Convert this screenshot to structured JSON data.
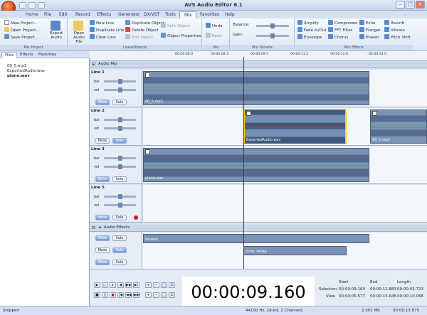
{
  "app": {
    "title": "AVS Audio Editor 6.1"
  },
  "menu": [
    "Home",
    "File",
    "Edit",
    "Record",
    "Effects",
    "Generator",
    "DX/VST",
    "Tools",
    "Mix",
    "Favorites",
    "Help"
  ],
  "active_menu": "Mix",
  "ribbon": {
    "mix_project": {
      "items": [
        "New Project...",
        "Open Project...",
        "Save Project..."
      ],
      "export": "Export Audio",
      "label": "Mix Project"
    },
    "lines_objects": {
      "open": "Open Audio File",
      "items": [
        "New Line",
        "Duplicate Line",
        "Clear Line",
        "Duplicate Object",
        "Delete Object",
        "Edit Object",
        "Split Object",
        "Object Properties"
      ],
      "label": "Lines/Objects"
    },
    "undo_redo": {
      "items": [
        "Undo",
        "Redo"
      ],
      "label": "Mix Undo/Redo"
    },
    "mix_volume": {
      "balance": "Balance:",
      "gain": "Gain:",
      "label": "Mix Volume"
    },
    "mix_effects": {
      "items": [
        "Amplify",
        "Compressor",
        "Echo",
        "Reverb",
        "Fade In/Out",
        "FFT Filter",
        "Flanger",
        "Vibrato",
        "Envelope",
        "Chorus",
        "Phaser",
        "Pitch Shift"
      ],
      "label": "Mix Effects"
    }
  },
  "left_panel": {
    "tabs": [
      "Files",
      "Effects",
      "Favorites"
    ],
    "files": [
      "00_5.mp3",
      "ExportedAudio.wav",
      "piano.wav"
    ]
  },
  "timeline": {
    "ticks": [
      "00:00:06.9",
      "00:00:08.3",
      "00:00:09.7",
      "00:00:11.2",
      "00:00:12.6",
      "00:00:14.0"
    ],
    "group": "Audio Mix"
  },
  "tracks": [
    {
      "name": "Line 1",
      "mute": "Mute",
      "solo": "Solo",
      "clips": [
        "00_5.mp3"
      ]
    },
    {
      "name": "Line 2",
      "mute": "Mute",
      "solo": "Solo",
      "clips": [
        "ExportedAudio.wav",
        "00_5.mp3"
      ]
    },
    {
      "name": "Line 3",
      "mute": "Mute",
      "solo": "Solo",
      "clips": [
        "piano.wav"
      ]
    },
    {
      "name": "Line 5",
      "mute": "Mute",
      "solo": "Solo",
      "clips": []
    }
  ],
  "effects_group": {
    "name": "Audio Effects",
    "rows": [
      {
        "mute": "Mute",
        "solo": "Solo",
        "label": "Reverb"
      },
      {
        "mute": "Mute",
        "solo": "Solo",
        "label": "Echo, Delay"
      },
      {
        "mute": "Mute",
        "solo": "Solo",
        "label": ""
      }
    ]
  },
  "transport": {
    "time": "00:00:09.160"
  },
  "selection": {
    "headers": [
      "Start",
      "End",
      "Length"
    ],
    "rows": [
      {
        "label": "Selection",
        "values": [
          "00:00:09.160",
          "00:00:12.883",
          "00:00:03.723"
        ]
      },
      {
        "label": "View",
        "values": [
          "00:00:05.577",
          "00:00:15.645",
          "00:00:10.068"
        ]
      }
    ]
  },
  "status": {
    "left": "Stopped",
    "format": "44100 Hz, 16-bit, 2 Channels",
    "size": "2.301 Mb",
    "duration": "00:00:13.675"
  },
  "colors": {
    "accent": "#ffd400",
    "clip": "#7d93b5",
    "selected": "#40597f"
  }
}
